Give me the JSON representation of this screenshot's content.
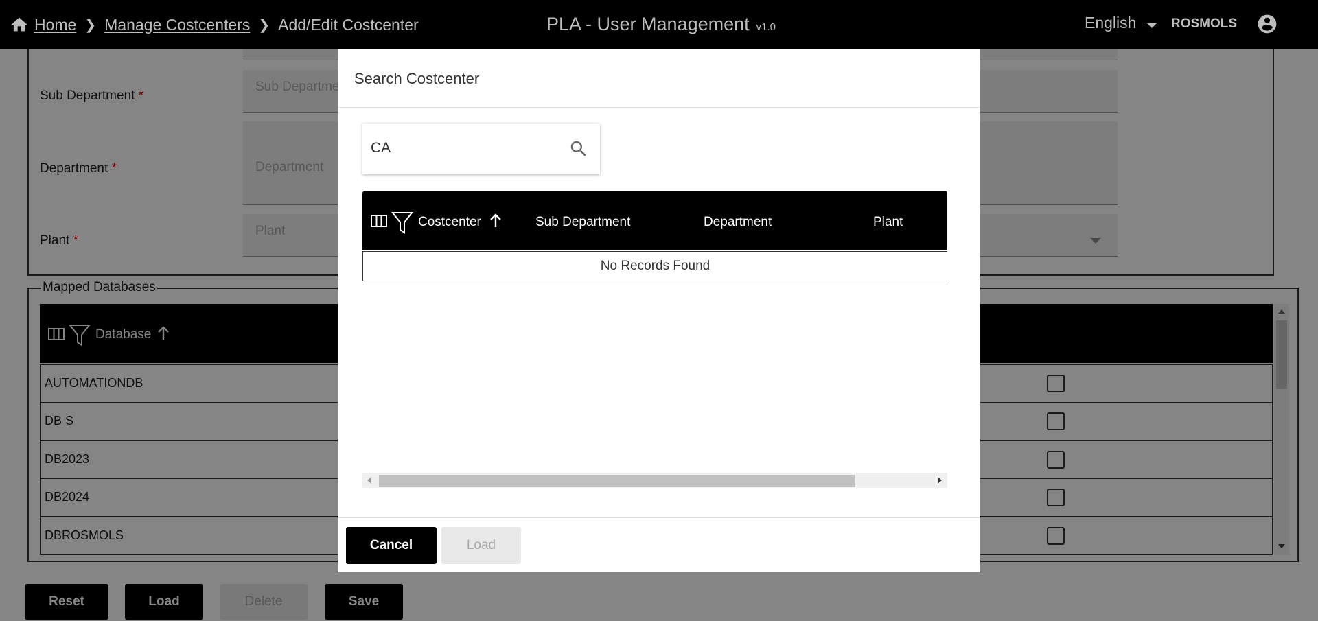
{
  "header": {
    "breadcrumb": {
      "home": "Home",
      "manage": "Manage Costcenters",
      "current": "Add/Edit Costcenter"
    },
    "app_title": "PLA - User Management",
    "version": "v1.0",
    "language": "English",
    "user": "ROSMOLS"
  },
  "form": {
    "sub_department": {
      "label": "Sub Department",
      "required": "*",
      "placeholder": "Sub Department"
    },
    "department": {
      "label": "Department",
      "required": "*",
      "placeholder": "Department"
    },
    "plant": {
      "label": "Plant",
      "required": "*",
      "placeholder": "Plant"
    }
  },
  "mapped_databases": {
    "legend": "Mapped Databases",
    "column": "Database",
    "rows": [
      "AUTOMATIONDB",
      "DB S",
      "DB2023",
      "DB2024",
      "DBROSMOLS"
    ]
  },
  "buttons": {
    "reset": "Reset",
    "load": "Load",
    "delete": "Delete",
    "save": "Save"
  },
  "modal": {
    "title": "Search Costcenter",
    "search_value": "CA",
    "columns": {
      "costcenter": "Costcenter",
      "sub_department": "Sub Department",
      "department": "Department",
      "plant": "Plant"
    },
    "empty_message": "No Records Found",
    "cancel": "Cancel",
    "load": "Load"
  },
  "colors": {
    "header_bg": "#000000",
    "overlay": "rgba(0,0,0,0.48)",
    "required": "#dd0000"
  },
  "icons": [
    "home-icon",
    "chevron-right-icon",
    "caret-down-icon",
    "account-circle-icon",
    "columns-icon",
    "filter-icon",
    "sort-asc-icon",
    "search-icon",
    "checkbox-icon"
  ]
}
